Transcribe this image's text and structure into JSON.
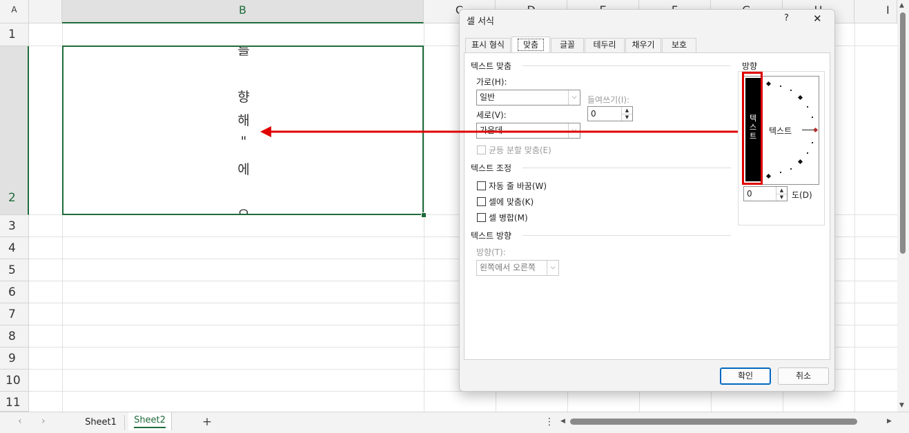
{
  "sheet": {
    "columns": [
      "A",
      "B",
      "C",
      "D",
      "E",
      "F",
      "G",
      "H",
      "I"
    ],
    "rows": [
      "1",
      "2",
      "3",
      "4",
      "5",
      "6",
      "7",
      "8",
      "9",
      "10",
      "11"
    ],
    "cell_text_chars": [
      "를",
      "향",
      "해",
      "\"",
      "에",
      "으"
    ]
  },
  "dialog": {
    "title": "셀 서식",
    "help_label": "?",
    "close_label": "✕",
    "tabs": [
      "표시 형식",
      "맞춤",
      "글꼴",
      "테두리",
      "채우기",
      "보호"
    ],
    "alignment": {
      "group_label": "텍스트 맞춤",
      "horizontal_label": "가로(H):",
      "horizontal_value": "일반",
      "indent_label": "들여쓰기(I):",
      "indent_value": "0",
      "vertical_label": "세로(V):",
      "vertical_value": "가운데",
      "justify_distributed_label": "균등 분할 맞춤(E)"
    },
    "text_control": {
      "group_label": "텍스트 조정",
      "wrap_label": "자동 줄 바꿈(W)",
      "shrink_label": "셀에 맞춤(K)",
      "merge_label": "셀 병합(M)"
    },
    "direction": {
      "group_label": "텍스트 방향",
      "label": "방향(T):",
      "value": "왼쪽에서 오른쪽"
    },
    "orientation": {
      "group_label": "방향",
      "vertical_text": "텍스트",
      "dial_text": "텍스트",
      "degrees_value": "0",
      "degrees_label": "도(D)"
    },
    "ok_label": "확인",
    "cancel_label": "취소"
  },
  "sheet_tabs": [
    "Sheet1",
    "Sheet2"
  ],
  "active_sheet": "Sheet2",
  "add_sheet_label": "+",
  "colors": {
    "selection": "#1e6b3a",
    "annotation": "#e00000",
    "accent": "#0067c0"
  }
}
